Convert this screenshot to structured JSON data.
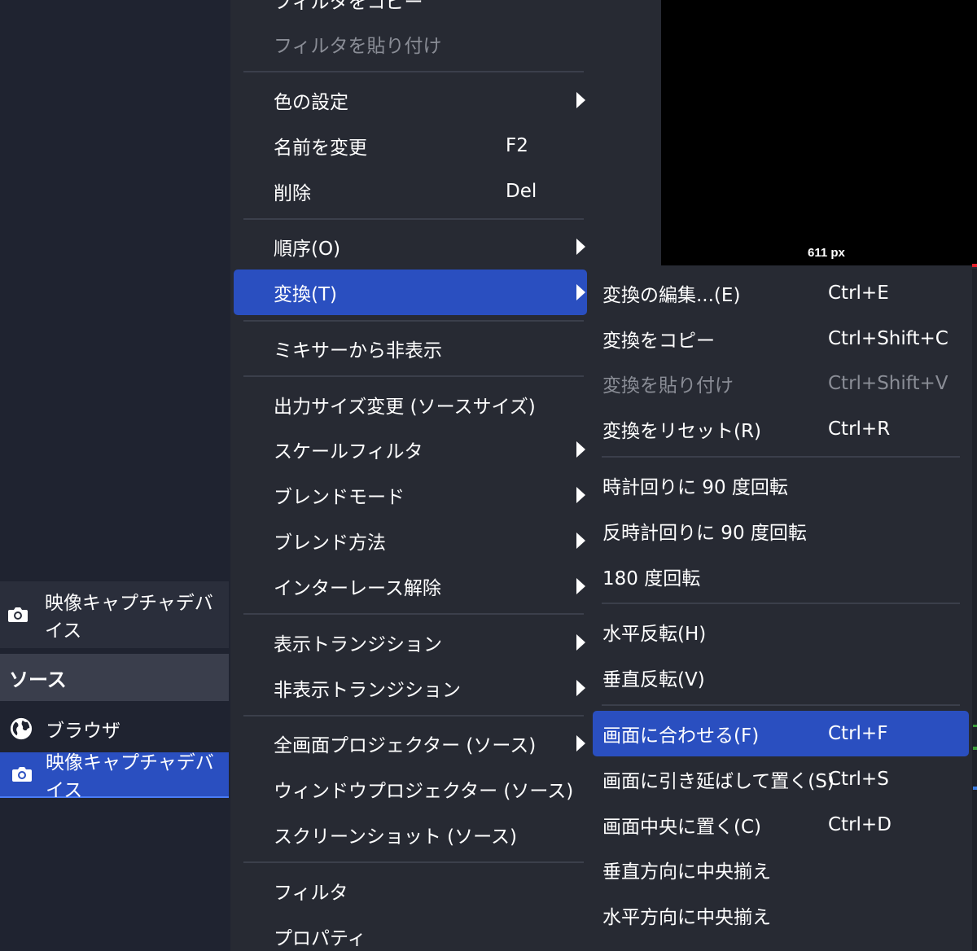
{
  "colors": {
    "menu_bg": "#272a33",
    "highlight": "#2a4fc0",
    "disabled_text": "#8a8d96",
    "preview_bg": "#000000"
  },
  "preview": {
    "size_label": "611 px"
  },
  "scenes": {
    "item_label": "映像キャプチャデバイス",
    "item_icon": "camera-icon"
  },
  "sources": {
    "header": "ソース",
    "items": [
      {
        "label": "ブラウザ",
        "icon": "globe-icon",
        "selected": false
      },
      {
        "label": "映像キャプチャデバイス",
        "icon": "camera-icon",
        "selected": true
      }
    ]
  },
  "context_menu": {
    "items": [
      {
        "label": "フィルタをコピー",
        "shortcut": "",
        "submenu": false,
        "disabled": false
      },
      {
        "label": "フィルタを貼り付け",
        "shortcut": "",
        "submenu": false,
        "disabled": true
      },
      {
        "label": "色の設定",
        "shortcut": "",
        "submenu": true,
        "disabled": false
      },
      {
        "label": "名前を変更",
        "shortcut": "F2",
        "submenu": false,
        "disabled": false
      },
      {
        "label": "削除",
        "shortcut": "Del",
        "submenu": false,
        "disabled": false
      },
      {
        "label": "順序(O)",
        "shortcut": "",
        "submenu": true,
        "disabled": false
      },
      {
        "label": "変換(T)",
        "shortcut": "",
        "submenu": true,
        "disabled": false,
        "highlighted": true
      },
      {
        "label": "ミキサーから非表示",
        "shortcut": "",
        "submenu": false,
        "disabled": false
      },
      {
        "label": "出力サイズ変更 (ソースサイズ)",
        "shortcut": "",
        "submenu": false,
        "disabled": false
      },
      {
        "label": "スケールフィルタ",
        "shortcut": "",
        "submenu": true,
        "disabled": false
      },
      {
        "label": "ブレンドモード",
        "shortcut": "",
        "submenu": true,
        "disabled": false
      },
      {
        "label": "ブレンド方法",
        "shortcut": "",
        "submenu": true,
        "disabled": false
      },
      {
        "label": "インターレース解除",
        "shortcut": "",
        "submenu": true,
        "disabled": false
      },
      {
        "label": "表示トランジション",
        "shortcut": "",
        "submenu": true,
        "disabled": false
      },
      {
        "label": "非表示トランジション",
        "shortcut": "",
        "submenu": true,
        "disabled": false
      },
      {
        "label": "全画面プロジェクター (ソース)",
        "shortcut": "",
        "submenu": true,
        "disabled": false
      },
      {
        "label": "ウィンドウプロジェクター (ソース)",
        "shortcut": "",
        "submenu": false,
        "disabled": false
      },
      {
        "label": "スクリーンショット (ソース)",
        "shortcut": "",
        "submenu": false,
        "disabled": false
      },
      {
        "label": "フィルタ",
        "shortcut": "",
        "submenu": false,
        "disabled": false
      },
      {
        "label": "プロパティ",
        "shortcut": "",
        "submenu": false,
        "disabled": false
      }
    ]
  },
  "transform_submenu": {
    "items": [
      {
        "label": "変換の編集...(E)",
        "shortcut": "Ctrl+E",
        "disabled": false
      },
      {
        "label": "変換をコピー",
        "shortcut": "Ctrl+Shift+C",
        "disabled": false
      },
      {
        "label": "変換を貼り付け",
        "shortcut": "Ctrl+Shift+V",
        "disabled": true
      },
      {
        "label": "変換をリセット(R)",
        "shortcut": "Ctrl+R",
        "disabled": false
      },
      {
        "label": "時計回りに 90 度回転",
        "shortcut": "",
        "disabled": false
      },
      {
        "label": "反時計回りに 90 度回転",
        "shortcut": "",
        "disabled": false
      },
      {
        "label": "180 度回転",
        "shortcut": "",
        "disabled": false
      },
      {
        "label": "水平反転(H)",
        "shortcut": "",
        "disabled": false
      },
      {
        "label": "垂直反転(V)",
        "shortcut": "",
        "disabled": false
      },
      {
        "label": "画面に合わせる(F)",
        "shortcut": "Ctrl+F",
        "disabled": false,
        "highlighted": true
      },
      {
        "label": "画面に引き延ばして置く(S)",
        "shortcut": "Ctrl+S",
        "disabled": false
      },
      {
        "label": "画面中央に置く(C)",
        "shortcut": "Ctrl+D",
        "disabled": false
      },
      {
        "label": "垂直方向に中央揃え",
        "shortcut": "",
        "disabled": false
      },
      {
        "label": "水平方向に中央揃え",
        "shortcut": "",
        "disabled": false
      }
    ]
  }
}
